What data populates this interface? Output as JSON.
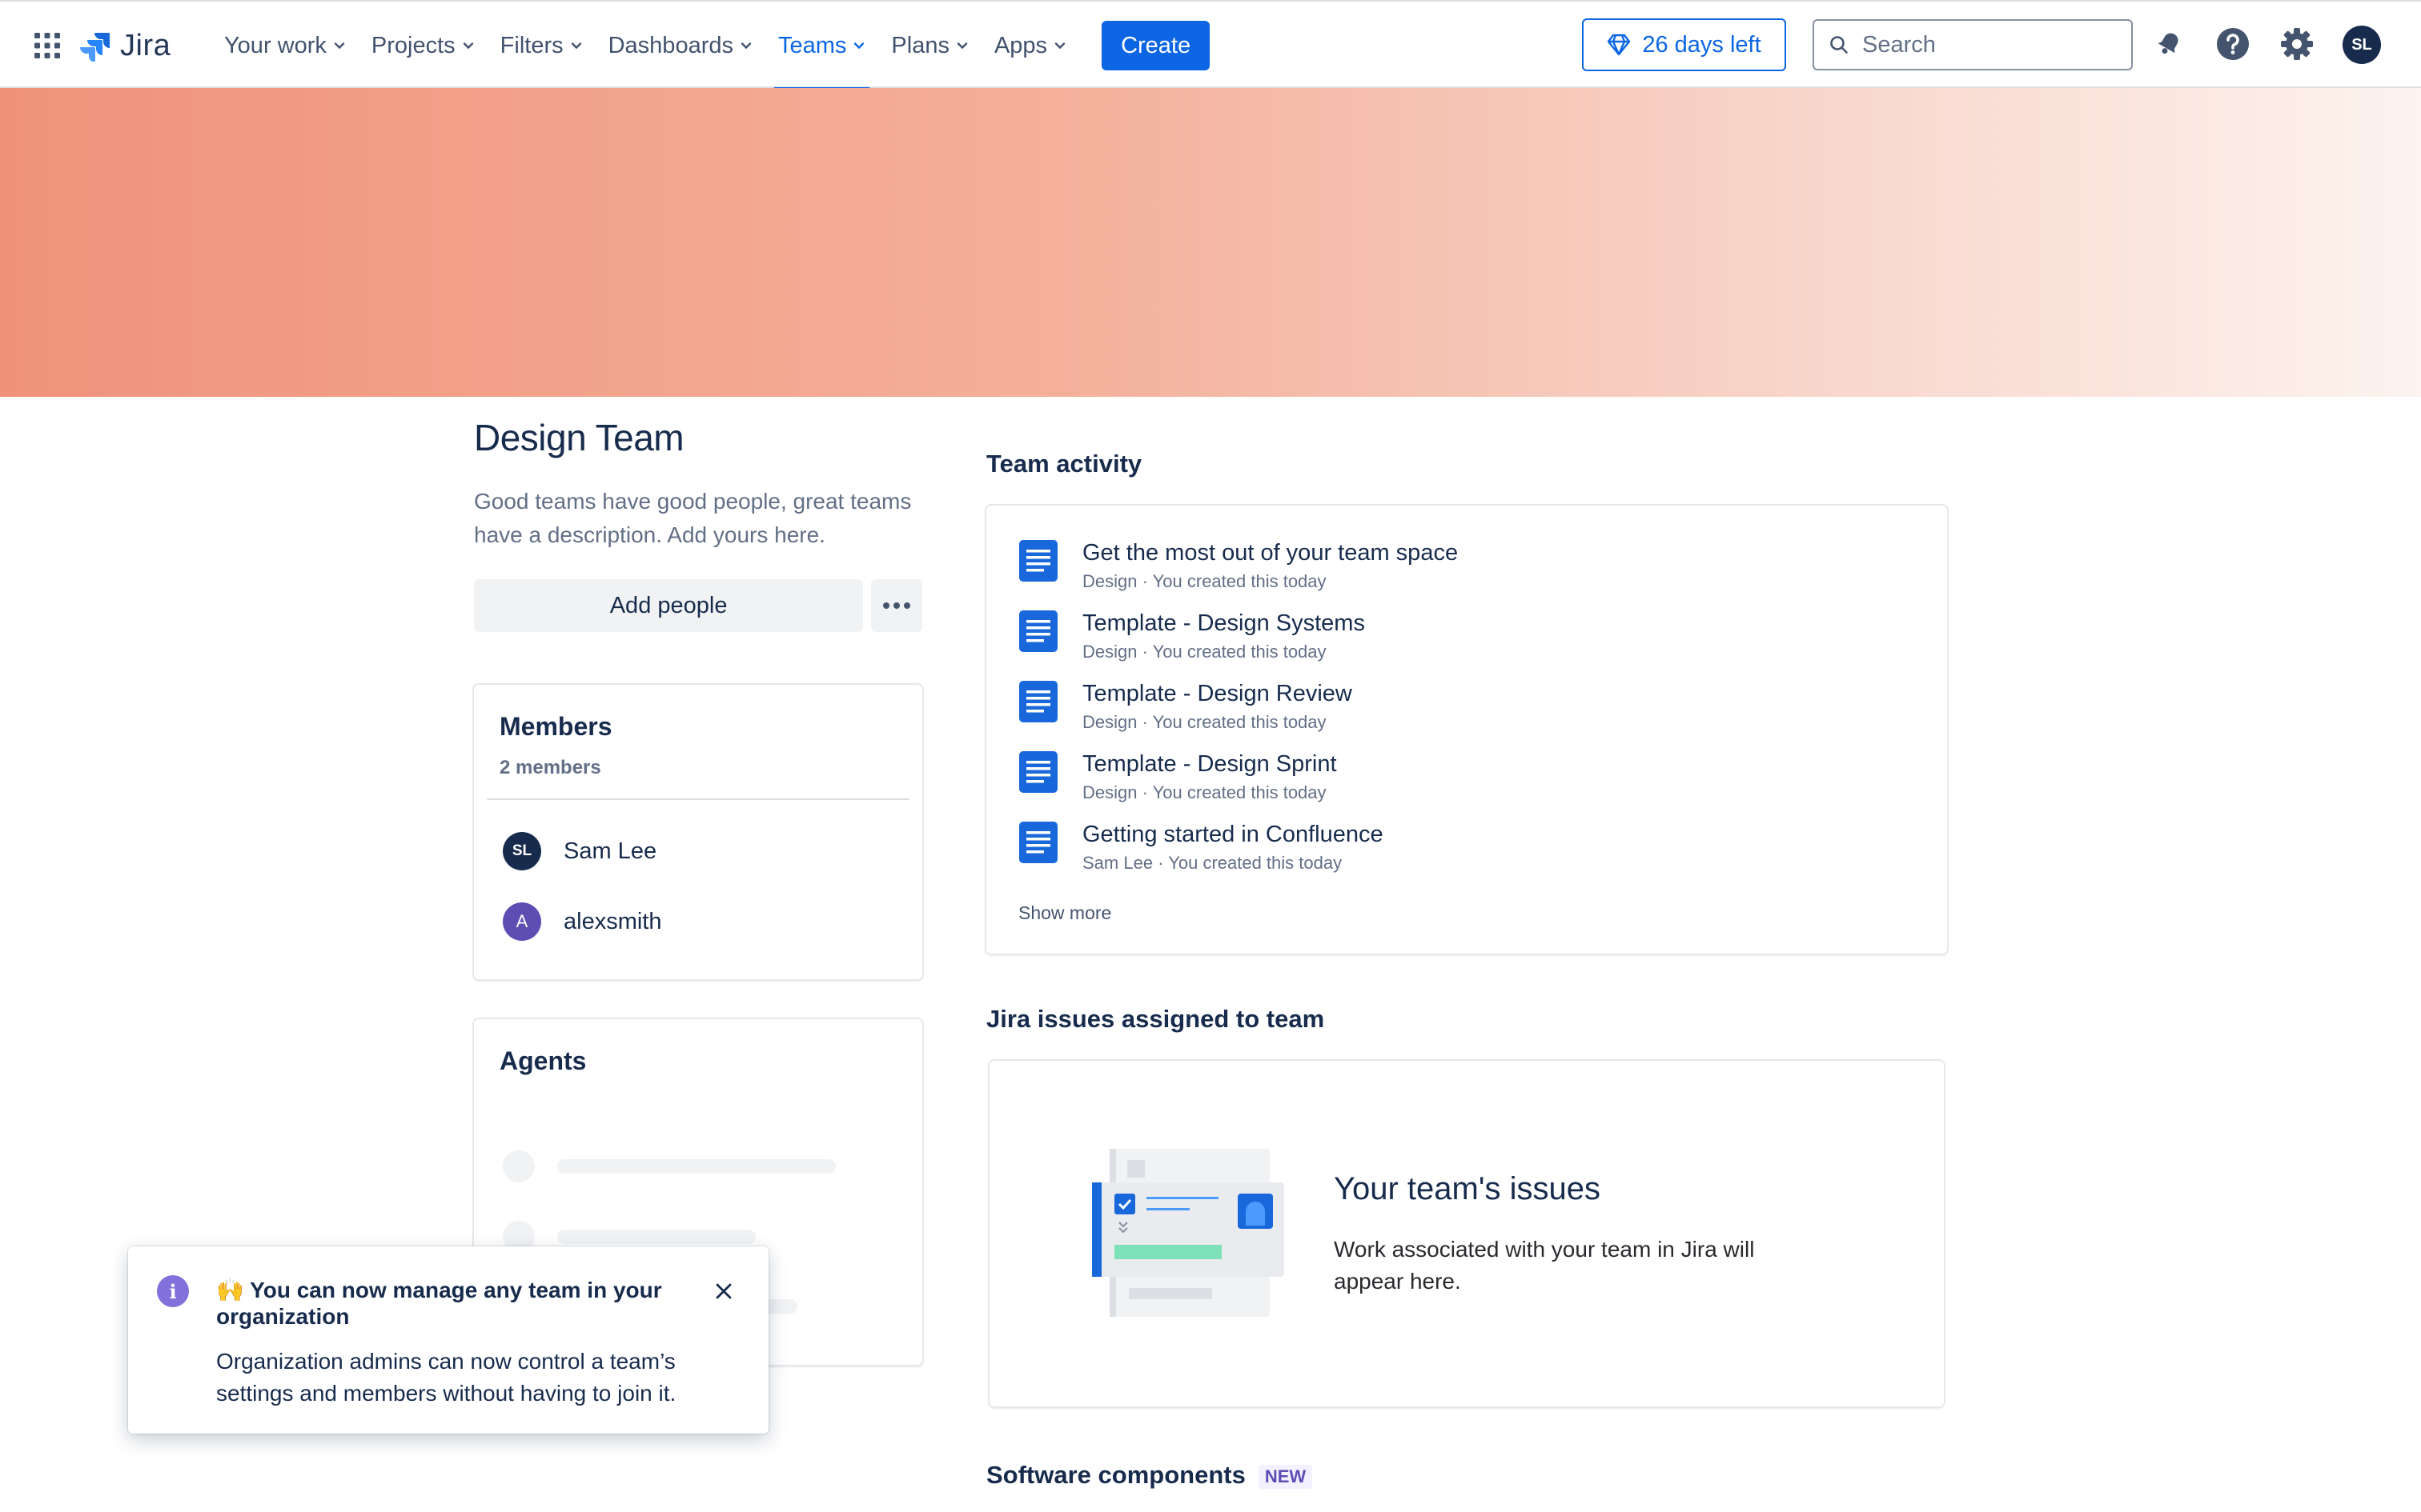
{
  "header": {
    "logo_text": "Jira",
    "nav": [
      {
        "label": "Your work"
      },
      {
        "label": "Projects"
      },
      {
        "label": "Filters"
      },
      {
        "label": "Dashboards"
      },
      {
        "label": "Teams",
        "active": true
      },
      {
        "label": "Plans"
      },
      {
        "label": "Apps"
      }
    ],
    "create_label": "Create",
    "trial_label": "26 days left",
    "search_placeholder": "Search",
    "user_initials": "SL",
    "icons": [
      "apps-grid-icon",
      "jira-logo-icon",
      "gem-icon",
      "search-icon",
      "notification-bell-icon",
      "help-icon",
      "settings-gear-icon"
    ]
  },
  "colors": {
    "accent": "#0c66e4",
    "banner_start": "#f0927a",
    "banner_end": "#fdf3ef",
    "doc_icon": "#1868db",
    "avatar_dark": "#172b4d",
    "avatar_purple": "#5e4db2",
    "info_purple": "#8270db"
  },
  "team": {
    "title": "Design Team",
    "description": "Good teams have good people, great teams have a description. Add yours here.",
    "add_people_label": "Add people"
  },
  "members": {
    "title": "Members",
    "count_label": "2 members",
    "list": [
      {
        "initials": "SL",
        "name": "Sam Lee"
      },
      {
        "initials": "A",
        "name": "alexsmith"
      }
    ]
  },
  "agents": {
    "title": "Agents"
  },
  "activity": {
    "title": "Team activity",
    "items": [
      {
        "title": "Get the most out of your team space",
        "meta": "Design · You created this today"
      },
      {
        "title": "Template - Design Systems",
        "meta": "Design · You created this today"
      },
      {
        "title": "Template - Design Review",
        "meta": "Design · You created this today"
      },
      {
        "title": "Template - Design Sprint",
        "meta": "Design · You created this today"
      },
      {
        "title": "Getting started in Confluence",
        "meta": "Sam Lee · You created this today"
      }
    ],
    "show_more_label": "Show more"
  },
  "issues": {
    "section_title": "Jira issues assigned to team",
    "heading": "Your team's issues",
    "description": "Work associated with your team in Jira will appear here."
  },
  "software_components": {
    "title": "Software components",
    "badge": "NEW"
  },
  "flag": {
    "title": "🙌 You can now manage any team in your organization",
    "body": "Organization admins can now control a team’s settings and members without having to join it."
  }
}
